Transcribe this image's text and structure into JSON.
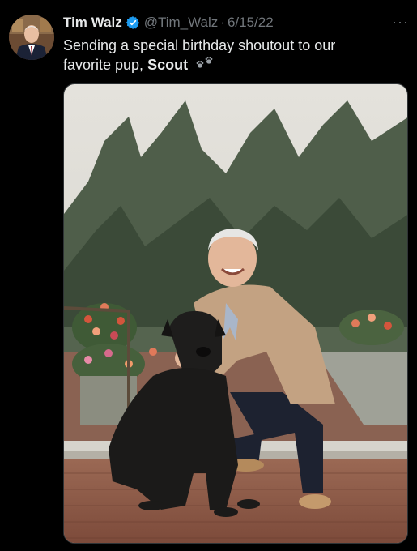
{
  "tweet": {
    "author_name": "Tim Walz",
    "handle": "@Tim_Walz",
    "separator": "·",
    "date": "6/15/22",
    "more_label": "···",
    "text_prefix": "Sending a special birthday shoutout to our favorite pup,",
    "text_bold": "Scout",
    "emoji": "paw-prints-icon",
    "photo_alt": "photo"
  },
  "colors": {
    "background": "#000000",
    "text": "#e7e9ea",
    "muted": "#71767b",
    "verified": "#1d9bf0"
  }
}
